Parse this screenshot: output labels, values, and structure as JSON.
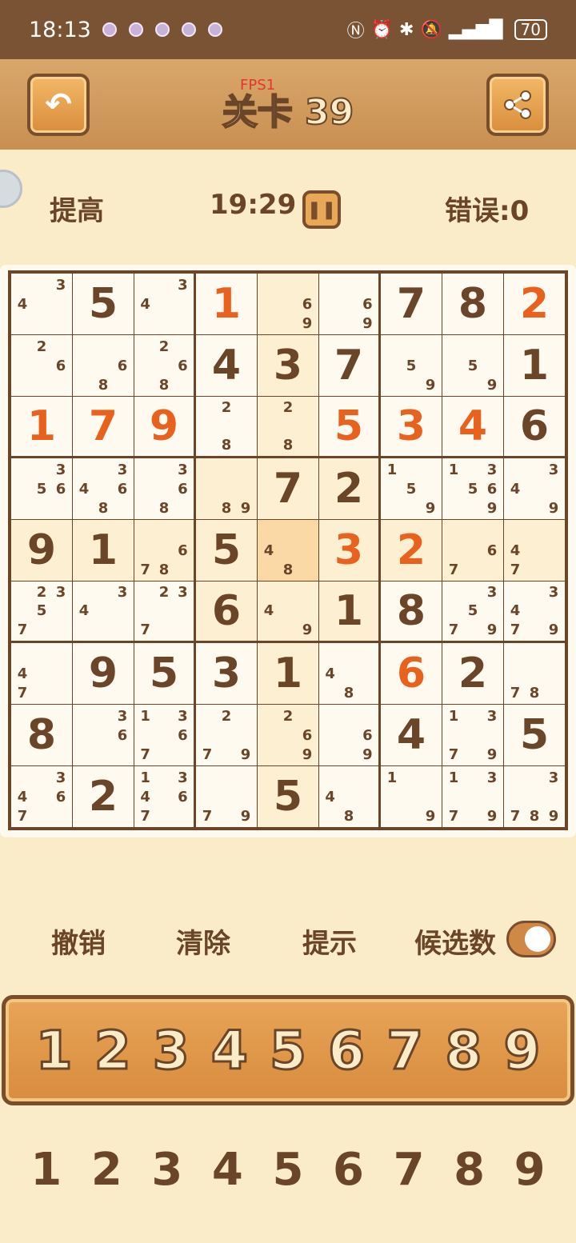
{
  "status_bar": {
    "time": "18:13",
    "battery": "70",
    "icons": [
      "app-icon",
      "app-icon",
      "app-icon",
      "app-icon",
      "app-icon"
    ]
  },
  "header": {
    "title": "关卡 39",
    "fps": "FPS1"
  },
  "info": {
    "difficulty": "提高",
    "timer": "19:29",
    "errors": "错误:0"
  },
  "board": {
    "rows": [
      [
        {
          "n": [
            3,
            4
          ]
        },
        {
          "v": 5
        },
        {
          "n": [
            3,
            4
          ]
        },
        {
          "v": 1,
          "u": true
        },
        {
          "n": [
            6,
            9
          ],
          "hl": true
        },
        {
          "n": [
            6,
            9
          ]
        },
        {
          "v": 7
        },
        {
          "v": 8
        },
        {
          "v": 2,
          "u": true
        }
      ],
      [
        {
          "n": [
            2,
            6
          ]
        },
        {
          "n": [
            6,
            8
          ]
        },
        {
          "n": [
            2,
            6,
            8
          ]
        },
        {
          "v": 4,
          "hl": false
        },
        {
          "v": 3,
          "hl": true
        },
        {
          "v": 7
        },
        {
          "n": [
            5,
            9
          ]
        },
        {
          "n": [
            5,
            9
          ]
        },
        {
          "v": 1
        }
      ],
      [
        {
          "v": 1,
          "u": true
        },
        {
          "v": 7,
          "u": true
        },
        {
          "v": 9,
          "u": true
        },
        {
          "n": [
            2,
            8
          ]
        },
        {
          "n": [
            2,
            8
          ],
          "hl": true
        },
        {
          "v": 5,
          "u": true
        },
        {
          "v": 3,
          "u": true
        },
        {
          "v": 4,
          "u": true
        },
        {
          "v": 6
        }
      ],
      [
        {
          "n": [
            3,
            5,
            6
          ]
        },
        {
          "n": [
            3,
            4,
            6,
            8
          ]
        },
        {
          "n": [
            3,
            6,
            8
          ]
        },
        {
          "n": [
            8,
            9
          ],
          "hl": true
        },
        {
          "v": 7,
          "hl": true
        },
        {
          "v": 2,
          "hl": true
        },
        {
          "n": [
            1,
            5,
            9
          ]
        },
        {
          "n": [
            1,
            3,
            5,
            6,
            9
          ]
        },
        {
          "n": [
            3,
            4,
            9
          ]
        }
      ],
      [
        {
          "v": 9,
          "hl": true
        },
        {
          "v": 1,
          "hl": true
        },
        {
          "n": [
            6,
            7,
            8
          ],
          "hl": true
        },
        {
          "v": 5,
          "hl": true
        },
        {
          "n": [
            4,
            8
          ],
          "sel": true
        },
        {
          "v": 3,
          "u": true,
          "hl": true
        },
        {
          "v": 2,
          "u": true,
          "hl": true
        },
        {
          "n": [
            6,
            7
          ],
          "hl": true
        },
        {
          "n": [
            4,
            7
          ],
          "hl": true
        }
      ],
      [
        {
          "n": [
            2,
            3,
            5,
            7
          ]
        },
        {
          "n": [
            3,
            4
          ]
        },
        {
          "n": [
            2,
            3,
            7
          ]
        },
        {
          "v": 6,
          "hl": true
        },
        {
          "n": [
            4,
            9
          ],
          "hl": true
        },
        {
          "v": 1,
          "hl": true
        },
        {
          "v": 8
        },
        {
          "n": [
            3,
            5,
            7,
            9
          ]
        },
        {
          "n": [
            3,
            4,
            7,
            9
          ]
        }
      ],
      [
        {
          "n": [
            4,
            7
          ]
        },
        {
          "v": 9
        },
        {
          "v": 5
        },
        {
          "v": 3
        },
        {
          "v": 1,
          "hl": true
        },
        {
          "n": [
            4,
            8
          ]
        },
        {
          "v": 6,
          "u": true
        },
        {
          "v": 2
        },
        {
          "n": [
            7,
            8
          ]
        }
      ],
      [
        {
          "v": 8
        },
        {
          "n": [
            3,
            6
          ]
        },
        {
          "n": [
            1,
            3,
            6,
            7
          ]
        },
        {
          "n": [
            2,
            7,
            9
          ]
        },
        {
          "n": [
            2,
            6,
            9
          ],
          "hl": true
        },
        {
          "n": [
            6,
            9
          ]
        },
        {
          "v": 4
        },
        {
          "n": [
            1,
            3,
            7,
            9
          ]
        },
        {
          "v": 5
        }
      ],
      [
        {
          "n": [
            3,
            4,
            6,
            7
          ]
        },
        {
          "v": 2
        },
        {
          "n": [
            1,
            3,
            4,
            6,
            7
          ]
        },
        {
          "n": [
            7,
            9
          ]
        },
        {
          "v": 5,
          "hl": true
        },
        {
          "n": [
            4,
            8
          ]
        },
        {
          "n": [
            1,
            9
          ]
        },
        {
          "n": [
            1,
            3,
            7,
            9
          ]
        },
        {
          "n": [
            3,
            7,
            8,
            9
          ]
        }
      ]
    ]
  },
  "controls": {
    "undo": "撤销",
    "clear": "清除",
    "hint": "提示",
    "candidates": "候选数",
    "candidates_on": true
  },
  "numpad": [
    "1",
    "2",
    "3",
    "4",
    "5",
    "6",
    "7",
    "8",
    "9"
  ],
  "counts": [
    "1",
    "2",
    "3",
    "4",
    "5",
    "6",
    "7",
    "8",
    "9"
  ]
}
